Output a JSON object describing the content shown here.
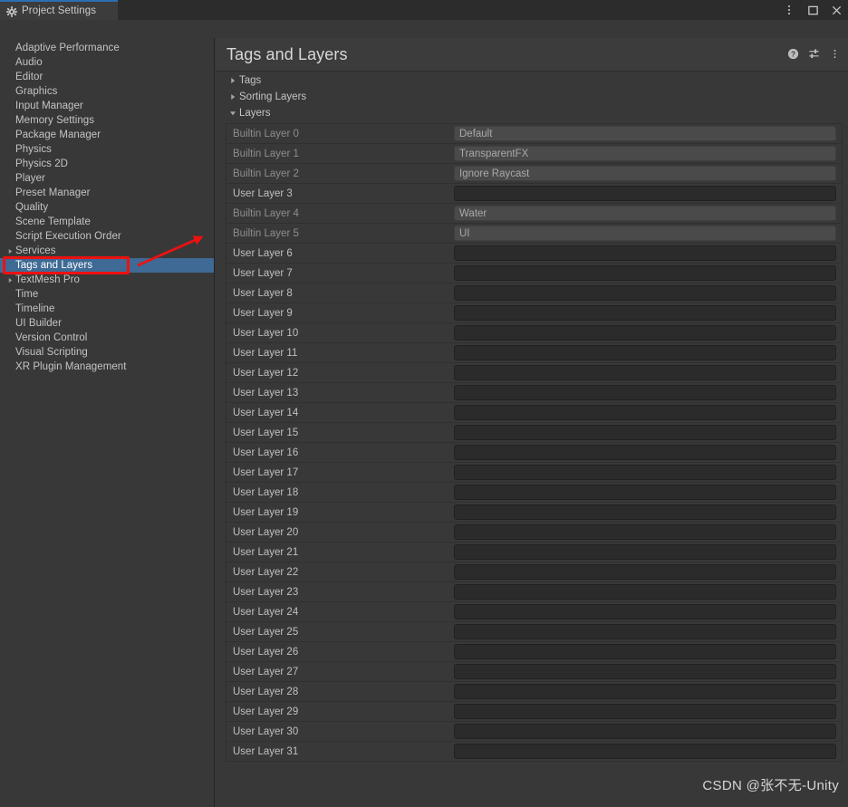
{
  "window": {
    "tab_title": "Project Settings",
    "tab_icon": "gear-icon",
    "controls": [
      {
        "name": "window-menu-button",
        "icon": "kebab-menu-icon"
      },
      {
        "name": "window-maximize-button",
        "icon": "maximize-icon"
      },
      {
        "name": "window-close-button",
        "icon": "close-icon"
      }
    ]
  },
  "search": {
    "value": "",
    "placeholder": "",
    "icon": "search-icon"
  },
  "sidebar": {
    "items": [
      {
        "label": "Adaptive Performance",
        "expandable": false,
        "selected": false
      },
      {
        "label": "Audio",
        "expandable": false,
        "selected": false
      },
      {
        "label": "Editor",
        "expandable": false,
        "selected": false
      },
      {
        "label": "Graphics",
        "expandable": false,
        "selected": false
      },
      {
        "label": "Input Manager",
        "expandable": false,
        "selected": false
      },
      {
        "label": "Memory Settings",
        "expandable": false,
        "selected": false
      },
      {
        "label": "Package Manager",
        "expandable": false,
        "selected": false
      },
      {
        "label": "Physics",
        "expandable": false,
        "selected": false
      },
      {
        "label": "Physics 2D",
        "expandable": false,
        "selected": false
      },
      {
        "label": "Player",
        "expandable": false,
        "selected": false
      },
      {
        "label": "Preset Manager",
        "expandable": false,
        "selected": false
      },
      {
        "label": "Quality",
        "expandable": false,
        "selected": false
      },
      {
        "label": "Scene Template",
        "expandable": false,
        "selected": false
      },
      {
        "label": "Script Execution Order",
        "expandable": false,
        "selected": false
      },
      {
        "label": "Services",
        "expandable": true,
        "selected": false
      },
      {
        "label": "Tags and Layers",
        "expandable": false,
        "selected": true
      },
      {
        "label": "TextMesh Pro",
        "expandable": true,
        "selected": false
      },
      {
        "label": "Time",
        "expandable": false,
        "selected": false
      },
      {
        "label": "Timeline",
        "expandable": false,
        "selected": false
      },
      {
        "label": "UI Builder",
        "expandable": false,
        "selected": false
      },
      {
        "label": "Version Control",
        "expandable": false,
        "selected": false
      },
      {
        "label": "Visual Scripting",
        "expandable": false,
        "selected": false
      },
      {
        "label": "XR Plugin Management",
        "expandable": false,
        "selected": false
      }
    ]
  },
  "panel": {
    "title": "Tags and Layers",
    "actions": [
      {
        "name": "help-button",
        "icon": "help-icon"
      },
      {
        "name": "preset-button",
        "icon": "preset-sliders-icon"
      },
      {
        "name": "panel-menu-button",
        "icon": "kebab-menu-icon"
      }
    ],
    "foldouts": [
      {
        "label": "Tags",
        "expanded": false
      },
      {
        "label": "Sorting Layers",
        "expanded": false
      },
      {
        "label": "Layers",
        "expanded": true
      }
    ],
    "layers": [
      {
        "label": "Builtin Layer 0",
        "value": "Default",
        "builtin": true
      },
      {
        "label": "Builtin Layer 1",
        "value": "TransparentFX",
        "builtin": true
      },
      {
        "label": "Builtin Layer 2",
        "value": "Ignore Raycast",
        "builtin": true
      },
      {
        "label": "User Layer 3",
        "value": "",
        "builtin": false
      },
      {
        "label": "Builtin Layer 4",
        "value": "Water",
        "builtin": true
      },
      {
        "label": "Builtin Layer 5",
        "value": "UI",
        "builtin": true
      },
      {
        "label": "User Layer 6",
        "value": "",
        "builtin": false
      },
      {
        "label": "User Layer 7",
        "value": "",
        "builtin": false
      },
      {
        "label": "User Layer 8",
        "value": "",
        "builtin": false
      },
      {
        "label": "User Layer 9",
        "value": "",
        "builtin": false
      },
      {
        "label": "User Layer 10",
        "value": "",
        "builtin": false
      },
      {
        "label": "User Layer 11",
        "value": "",
        "builtin": false
      },
      {
        "label": "User Layer 12",
        "value": "",
        "builtin": false
      },
      {
        "label": "User Layer 13",
        "value": "",
        "builtin": false
      },
      {
        "label": "User Layer 14",
        "value": "",
        "builtin": false
      },
      {
        "label": "User Layer 15",
        "value": "",
        "builtin": false
      },
      {
        "label": "User Layer 16",
        "value": "",
        "builtin": false
      },
      {
        "label": "User Layer 17",
        "value": "",
        "builtin": false
      },
      {
        "label": "User Layer 18",
        "value": "",
        "builtin": false
      },
      {
        "label": "User Layer 19",
        "value": "",
        "builtin": false
      },
      {
        "label": "User Layer 20",
        "value": "",
        "builtin": false
      },
      {
        "label": "User Layer 21",
        "value": "",
        "builtin": false
      },
      {
        "label": "User Layer 22",
        "value": "",
        "builtin": false
      },
      {
        "label": "User Layer 23",
        "value": "",
        "builtin": false
      },
      {
        "label": "User Layer 24",
        "value": "",
        "builtin": false
      },
      {
        "label": "User Layer 25",
        "value": "",
        "builtin": false
      },
      {
        "label": "User Layer 26",
        "value": "",
        "builtin": false
      },
      {
        "label": "User Layer 27",
        "value": "",
        "builtin": false
      },
      {
        "label": "User Layer 28",
        "value": "",
        "builtin": false
      },
      {
        "label": "User Layer 29",
        "value": "",
        "builtin": false
      },
      {
        "label": "User Layer 30",
        "value": "",
        "builtin": false
      },
      {
        "label": "User Layer 31",
        "value": "",
        "builtin": false
      }
    ]
  },
  "watermark": {
    "text": "CSDN @张不无-Unity"
  },
  "annotation": {
    "color": "#ee1111",
    "target": "Tags and Layers"
  },
  "colors": {
    "background": "#383838",
    "titlebar": "#2c2c2c",
    "selection_blue": "#3e6a95",
    "tab_accent": "#2c6fb0",
    "field_readonly": "#4a4a4a",
    "field_editable": "#2b2b2b",
    "annotation_red": "#ee1111"
  }
}
